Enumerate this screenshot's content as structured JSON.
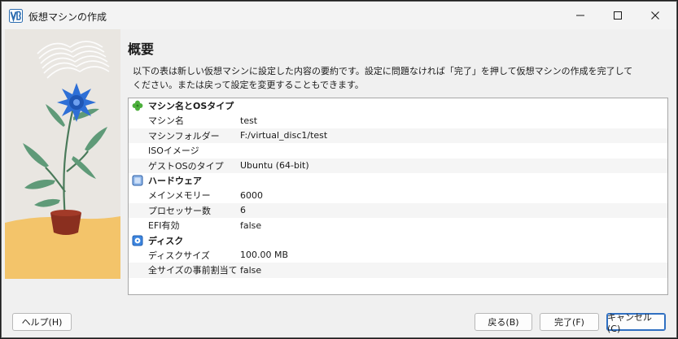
{
  "window": {
    "title": "仮想マシンの作成",
    "app_icon": "virtualbox-icon"
  },
  "controls": {
    "minimize_icon": "minimize-icon",
    "maximize_icon": "maximize-icon",
    "close_icon": "close-icon"
  },
  "page": {
    "title": "概要",
    "description": "以下の表は新しい仮想マシンに設定した内容の要約です。設定に問題なければ「完了」を押して仮想マシンの作成を完了してください。または戻って設定を変更することもできます。"
  },
  "summary": {
    "sections": [
      {
        "title": "マシン名とOSタイプ",
        "icon": "clover-icon",
        "items": [
          {
            "label": "マシン名",
            "value": "test"
          },
          {
            "label": "マシンフォルダー",
            "value": "F:/virtual_disc1/test"
          },
          {
            "label": "ISOイメージ",
            "value": ""
          },
          {
            "label": "ゲストOSのタイプ",
            "value": "Ubuntu (64-bit)"
          }
        ]
      },
      {
        "title": "ハードウェア",
        "icon": "chip-icon",
        "items": [
          {
            "label": "メインメモリー",
            "value": "6000"
          },
          {
            "label": "プロセッサー数",
            "value": "6"
          },
          {
            "label": "EFI有効",
            "value": "false"
          }
        ]
      },
      {
        "title": "ディスク",
        "icon": "disk-icon",
        "items": [
          {
            "label": "ディスクサイズ",
            "value": "100.00 MB"
          },
          {
            "label": "全サイズの事前割当て",
            "value": "false"
          }
        ]
      }
    ]
  },
  "buttons": {
    "help": "ヘルプ(H)",
    "back": "戻る(B)",
    "finish": "完了(F)",
    "cancel": "キャンセル(C)"
  },
  "colors": {
    "accent": "#2f6fc1",
    "flower": "#2e6fd6",
    "pot": "#8a2f1f",
    "ground": "#f3c46a"
  }
}
